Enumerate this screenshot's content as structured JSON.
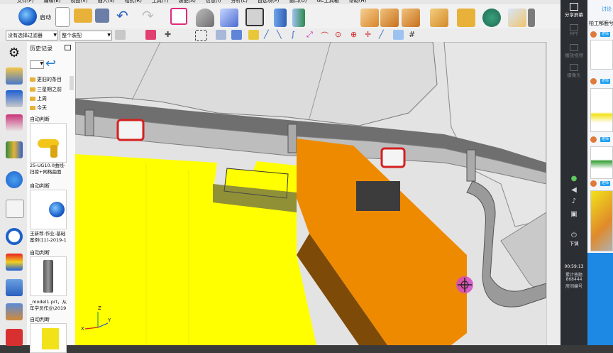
{
  "menu": {
    "items": [
      "文件(F)",
      "编辑(E)",
      "视图(V)",
      "插入(S)",
      "格式(R)",
      "工具(T)",
      "装配(A)",
      "信息(I)",
      "分析(L)",
      "首选项(P)",
      "窗口(O)",
      "GC工具箱",
      "帮助(H)"
    ]
  },
  "toolbar": {
    "start_label": "启动"
  },
  "filters": {
    "selection_filter": "没有选择过滤器",
    "assembly_scope": "整个装配"
  },
  "history_panel": {
    "title": "历史记录",
    "folders": [
      "更旧的条目",
      "三星期之前",
      "上周",
      "今天"
    ],
    "entries": [
      {
        "status": "自动判断",
        "caption_line1": "25-UG10.0曲线-",
        "caption_line2": "扫掠+网格曲面"
      },
      {
        "status": "自动判断",
        "caption_line1": "王新荐-作业-基础",
        "caption_line2": "案例(11)-2019-1"
      },
      {
        "status": "自动判断",
        "caption_line1": "_model1.prt，从",
        "caption_line2": "年学员作业\\2019"
      },
      {
        "status": "自动判断",
        "caption_line1": "",
        "caption_line2": ""
      }
    ]
  },
  "viewport": {
    "axis_labels": {
      "x": "X",
      "y": "Y",
      "z": "Z"
    },
    "colors": {
      "yellow": "#ffff00",
      "orange": "#ee8a00",
      "gray_wall": "#6f6f6f",
      "background": "#e3e3e3",
      "red_clip": "#d42020"
    }
  },
  "share_app": {
    "share_screen": "分享屏幕",
    "ppt": "PPT",
    "playback": "播放视频",
    "camera": "摄像头",
    "leave": "下课",
    "timer": "00:59:13",
    "stats_line1": "累计答题",
    "stats_line2": "868444",
    "stats_line3": "房间编号",
    "chat_header": "讨论",
    "chat_message": "柏工郁鹿兮",
    "teacher_tag": "老师"
  }
}
